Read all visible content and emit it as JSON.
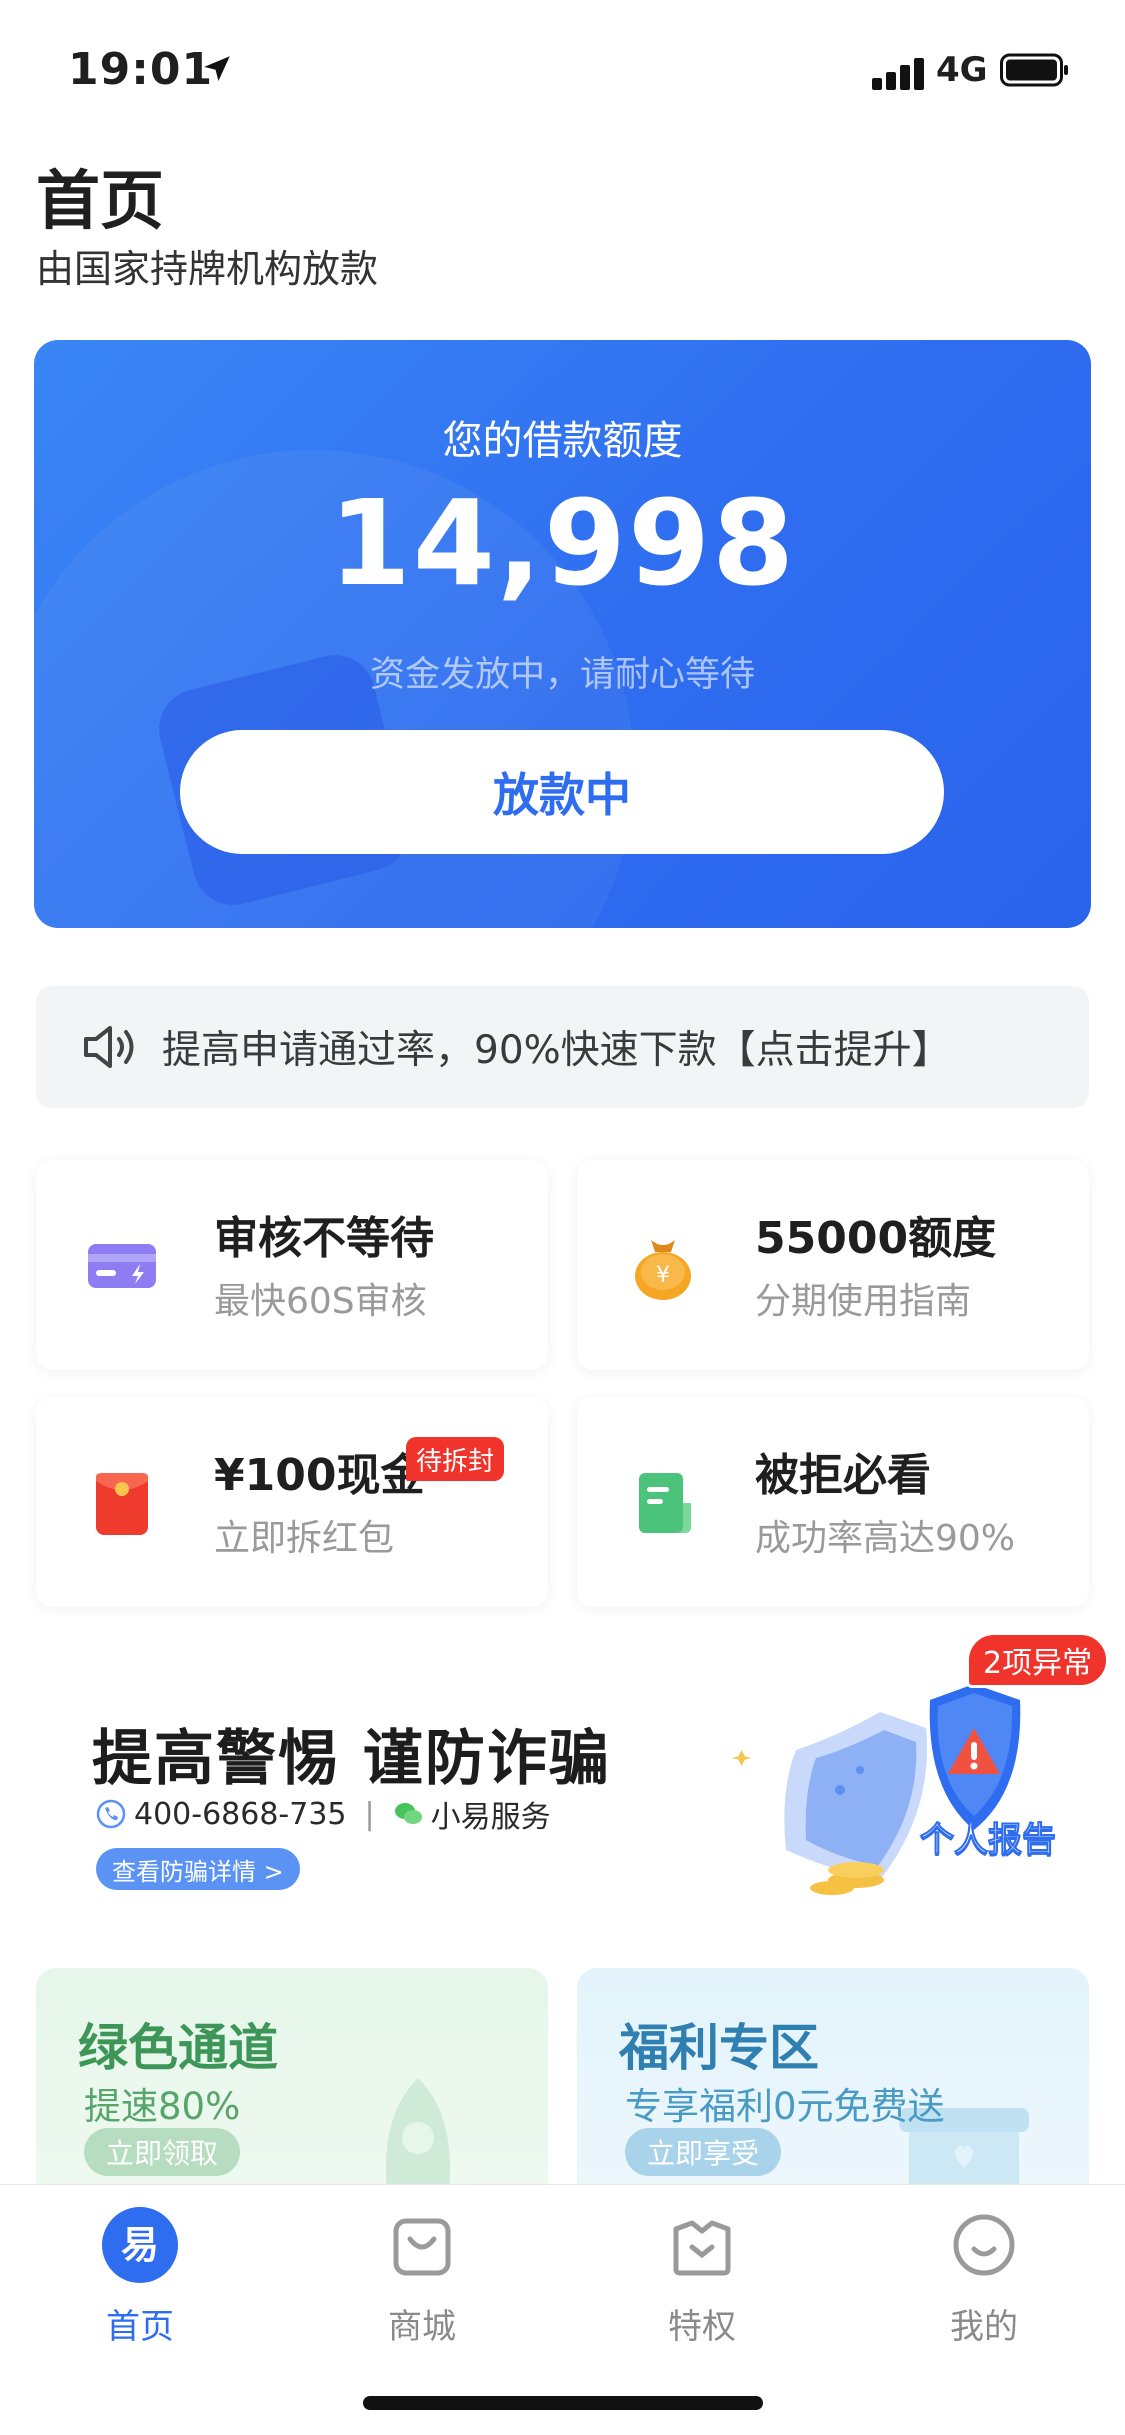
{
  "status_bar": {
    "time": "19:01",
    "network": "4G"
  },
  "header": {
    "title": "首页",
    "subtitle": "由国家持牌机构放款"
  },
  "hero": {
    "label": "您的借款额度",
    "amount": "14,998",
    "note": "资金发放中，请耐心等待",
    "button_label": "放款中"
  },
  "notice": {
    "icon": "speaker-icon",
    "text": "提高申请通过率，90%快速下款【点击提升】"
  },
  "features": [
    {
      "title": "审核不等待",
      "subtitle": "最快60S审核",
      "icon": "card-icon"
    },
    {
      "title": "55000额度",
      "subtitle": "分期使用指南",
      "icon": "money-bag-icon"
    },
    {
      "title": "¥100现金",
      "subtitle": "立即拆红包",
      "badge": "待拆封",
      "icon": "red-envelope-icon"
    },
    {
      "title": "被拒必看",
      "subtitle": "成功率高达90%",
      "icon": "document-icon"
    }
  ],
  "banner": {
    "title": "提高警惕 谨防诈骗",
    "phone": "400-6868-735",
    "service": "小易服务",
    "link_label": "查看防骗详情 >",
    "badge": "2项异常",
    "report_label": "个人报告"
  },
  "promos": [
    {
      "title": "绿色通道",
      "subtitle": "提速80%",
      "button_label": "立即领取"
    },
    {
      "title": "福利专区",
      "subtitle": "专享福利0元免费送",
      "button_label": "立即享受"
    }
  ],
  "tabs": [
    {
      "label": "首页",
      "icon": "home-logo-icon",
      "active": true
    },
    {
      "label": "商城",
      "icon": "shopping-bag-icon"
    },
    {
      "label": "特权",
      "icon": "privilege-icon"
    },
    {
      "label": "我的",
      "icon": "smiley-icon"
    }
  ],
  "colors": {
    "primary": "#2f6df0",
    "alert_red": "#f0332b",
    "green": "#3d9658"
  }
}
